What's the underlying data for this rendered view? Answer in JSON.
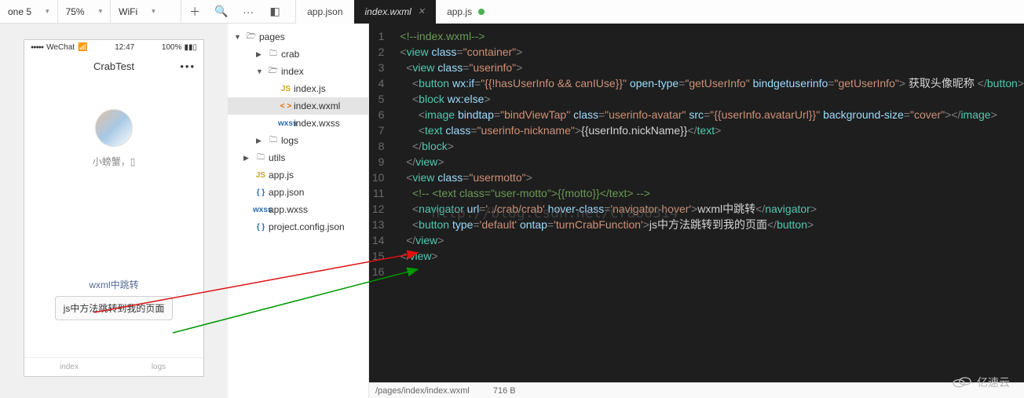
{
  "toolbar": {
    "device": "one 5",
    "zoom": "75%",
    "network": "WiFi"
  },
  "etabs": [
    {
      "label": "app.json",
      "active": false,
      "dirty": false
    },
    {
      "label": "index.wxml",
      "active": true,
      "dirty": false
    },
    {
      "label": "app.js",
      "active": false,
      "dirty": true
    }
  ],
  "simulator": {
    "carrier": "WeChat",
    "signal": "●●●●●",
    "wifi": "📶",
    "time": "12:47",
    "battery": "100%",
    "title": "CrabTest",
    "nickname": "小螃蟹，▯",
    "navlink": "wxml中跳转",
    "jsbtn": "js中方法跳转到我的页面",
    "tab_index": "index",
    "tab_logs": "logs"
  },
  "tree": {
    "root": "pages",
    "items": [
      {
        "indent": 1,
        "twist": "▶",
        "icon": "folder",
        "label": "crab"
      },
      {
        "indent": 1,
        "twist": "▼",
        "icon": "folder-open",
        "label": "index"
      },
      {
        "indent": 2,
        "twist": "",
        "icon": "js",
        "label": "index.js"
      },
      {
        "indent": 2,
        "twist": "",
        "icon": "wxml",
        "label": "index.wxml",
        "sel": true
      },
      {
        "indent": 2,
        "twist": "",
        "icon": "wxss",
        "label": "index.wxss"
      },
      {
        "indent": 1,
        "twist": "▶",
        "icon": "folder",
        "label": "logs"
      },
      {
        "indent": 0,
        "twist": "▶",
        "icon": "folder",
        "label": "utils"
      },
      {
        "indent": 0,
        "twist": "",
        "icon": "js",
        "label": "app.js"
      },
      {
        "indent": 0,
        "twist": "",
        "icon": "json",
        "label": "app.json"
      },
      {
        "indent": 0,
        "twist": "",
        "icon": "wxss",
        "label": "app.wxss"
      },
      {
        "indent": 0,
        "twist": "",
        "icon": "proj",
        "label": "project.config.json"
      }
    ]
  },
  "code": {
    "watermark": "http://blog.csdn.net/Crab0314",
    "lines": [
      "<!--index.wxml-->",
      "<view class=\"container\">",
      "  <view class=\"userinfo\">",
      "    <button wx:if=\"{{!hasUserInfo && canIUse}}\" open-type=\"getUserInfo\" bindgetuserinfo=\"getUserInfo\"> 获取头像昵称 </button>",
      "    <block wx:else>",
      "      <image bindtap=\"bindViewTap\" class=\"userinfo-avatar\" src=\"{{userInfo.avatarUrl}}\" background-size=\"cover\"></image>",
      "      <text class=\"userinfo-nickname\">{{userInfo.nickName}}</text>",
      "    </block>",
      "  </view>",
      "  <view class=\"usermotto\">",
      "    <!-- <text class=\"user-motto\">{{motto}}</text> -->",
      "    <navigator url='../crab/crab' hover-class='navigator-hover'>wxml中跳转</navigator>",
      "    <button type='default' ontap='turnCrabFunction'>js中方法跳转到我的页面</button>",
      "  </view>",
      "</view>",
      ""
    ]
  },
  "status": {
    "path": "/pages/index/index.wxml",
    "size": "716 B"
  },
  "brand": "亿速云"
}
